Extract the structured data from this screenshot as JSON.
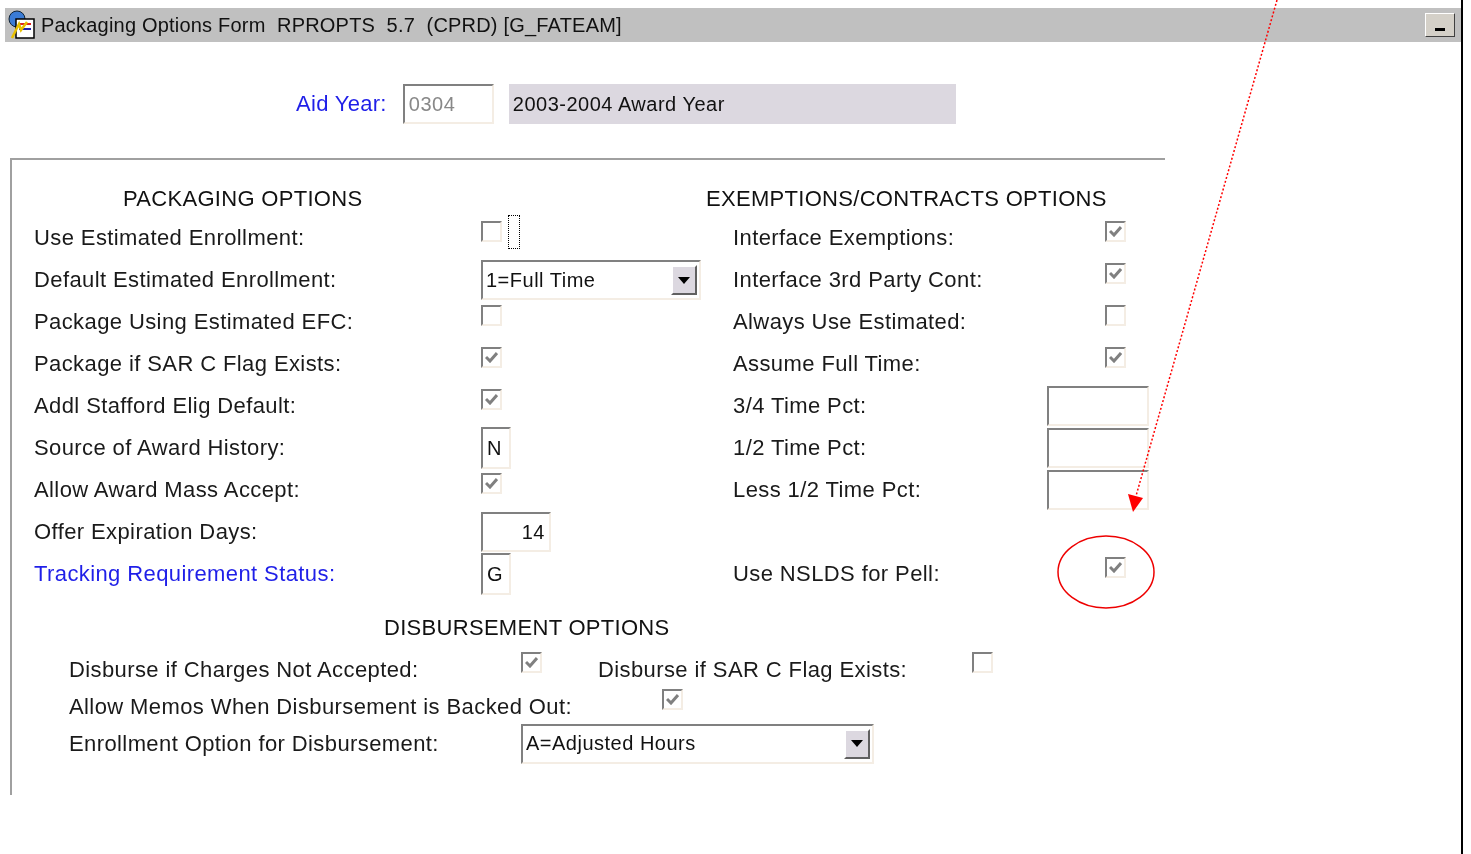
{
  "window": {
    "title": "Packaging Options Form  RPROPTS  5.7  (CPRD) [G_FATEAM]"
  },
  "aid_year": {
    "label": "Aid Year:",
    "value": "0304",
    "description": "2003-2004 Award Year"
  },
  "packaging": {
    "heading": "PACKAGING OPTIONS",
    "items": [
      {
        "label": "Use Estimated Enrollment:",
        "kind": "checkbox",
        "checked": false,
        "focused": true,
        "link": false
      },
      {
        "label": "Default Estimated Enrollment:",
        "kind": "select",
        "value": "1=Full Time",
        "focused": false,
        "link": false
      },
      {
        "label": "Package Using Estimated EFC:",
        "kind": "checkbox",
        "checked": false,
        "focused": false,
        "link": false
      },
      {
        "label": "Package if SAR C Flag Exists:",
        "kind": "checkbox",
        "checked": true,
        "focused": false,
        "link": false
      },
      {
        "label": "Addl Stafford Elig Default:",
        "kind": "checkbox",
        "checked": true,
        "focused": false,
        "link": false
      },
      {
        "label": "Source of Award History:",
        "kind": "char",
        "value": "N",
        "focused": false,
        "link": false
      },
      {
        "label": "Allow Award Mass Accept:",
        "kind": "checkbox",
        "checked": true,
        "focused": false,
        "link": false
      },
      {
        "label": "Offer Expiration Days:",
        "kind": "number",
        "value": "14",
        "focused": false,
        "link": false
      },
      {
        "label": "Tracking Requirement Status:",
        "kind": "char",
        "value": "G",
        "focused": false,
        "link": true
      }
    ]
  },
  "exemptions": {
    "heading": "EXEMPTIONS/CONTRACTS OPTIONS",
    "items": [
      {
        "label": "Interface Exemptions:",
        "kind": "checkbox",
        "checked": true
      },
      {
        "label": "Interface 3rd Party Cont:",
        "kind": "checkbox",
        "checked": true
      },
      {
        "label": "Always Use Estimated:",
        "kind": "checkbox",
        "checked": false
      },
      {
        "label": "Assume Full Time:",
        "kind": "checkbox",
        "checked": true
      },
      {
        "label": "3/4 Time Pct:",
        "kind": "text"
      },
      {
        "label": "1/2 Time Pct:",
        "kind": "text"
      },
      {
        "label": "Less 1/2 Time Pct:",
        "kind": "text"
      }
    ],
    "pell": {
      "label": "Use NSLDS for Pell:",
      "kind": "checkbox",
      "checked": true
    }
  },
  "disbursement": {
    "heading": "DISBURSEMENT OPTIONS",
    "rows": [
      [
        {
          "label": "Disburse if Charges Not Accepted:",
          "kind": "checkbox",
          "checked": true
        },
        {
          "label": "Disburse if SAR C Flag Exists:",
          "kind": "checkbox",
          "checked": false
        }
      ],
      [
        {
          "label": "Allow Memos When Disbursement is Backed Out:",
          "kind": "checkbox",
          "checked": true
        }
      ],
      [
        {
          "label": "Enrollment Option for Disbursement:",
          "kind": "select",
          "value": "A=Adjusted Hours"
        }
      ]
    ]
  }
}
